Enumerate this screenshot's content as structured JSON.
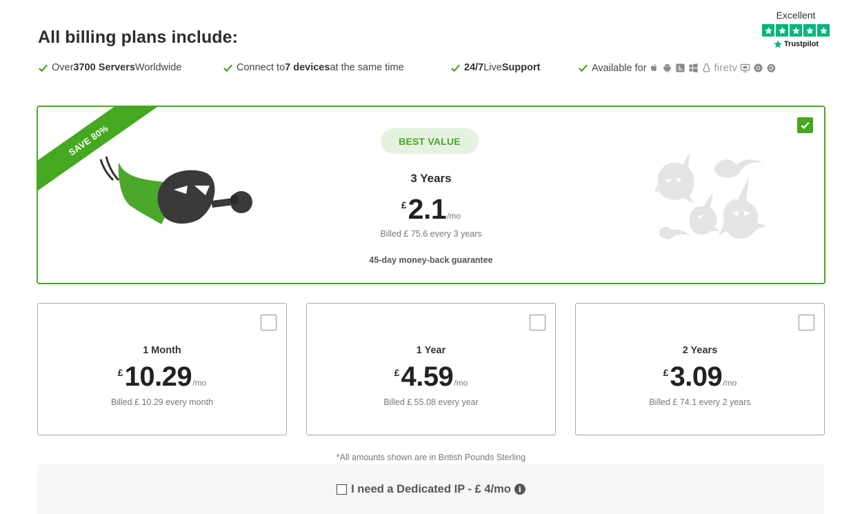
{
  "header": {
    "title": "All billing plans include:"
  },
  "trustpilot": {
    "rating": "Excellent",
    "brand": "Trustpilot",
    "stars": 5,
    "color": "#00b67a"
  },
  "features": [
    {
      "pre": "Over ",
      "bold": "3700 Servers",
      "post": " Worldwide"
    },
    {
      "pre": "Connect to ",
      "bold": "7 devices",
      "post": " at the same time"
    },
    {
      "bold1": "24/7",
      "mid": " Live ",
      "bold2": "Support"
    },
    {
      "pre": "Available for",
      "firetv": "firetv",
      "platform_icons": [
        "apple-icon",
        "android-icon",
        "finder-icon",
        "windows-icon",
        "linux-icon",
        "firetv-icon",
        "router-icon",
        "chrome-icon",
        "firefox-icon"
      ]
    }
  ],
  "best_plan": {
    "ribbon": "SAVE 80%",
    "badge": "BEST VALUE",
    "term": "3 Years",
    "currency": "£",
    "amount": "2.1",
    "per": "/mo",
    "billed": "Billed £ 75.6 every 3 years",
    "guarantee": "45-day money-back guarantee",
    "selected": true
  },
  "plans": [
    {
      "term": "1 Month",
      "currency": "£",
      "amount": "10.29",
      "per": "/mo",
      "billed": "Billed £ 10.29 every month",
      "selected": false
    },
    {
      "term": "1 Year",
      "currency": "£",
      "amount": "4.59",
      "per": "/mo",
      "billed": "Billed £ 55.08 every year",
      "selected": false
    },
    {
      "term": "2 Years",
      "currency": "£",
      "amount": "3.09",
      "per": "/mo",
      "billed": "Billed £ 74.1 every 2 years",
      "selected": false
    }
  ],
  "footnote": "*All amounts shown are in British Pounds Sterling",
  "dedicated_ip": {
    "label": "I need a Dedicated IP - £ 4/mo",
    "info_glyph": "i",
    "checked": false
  },
  "colors": {
    "accent": "#44a820",
    "badge_bg": "#e6f2e0",
    "trustpilot": "#00b67a"
  }
}
